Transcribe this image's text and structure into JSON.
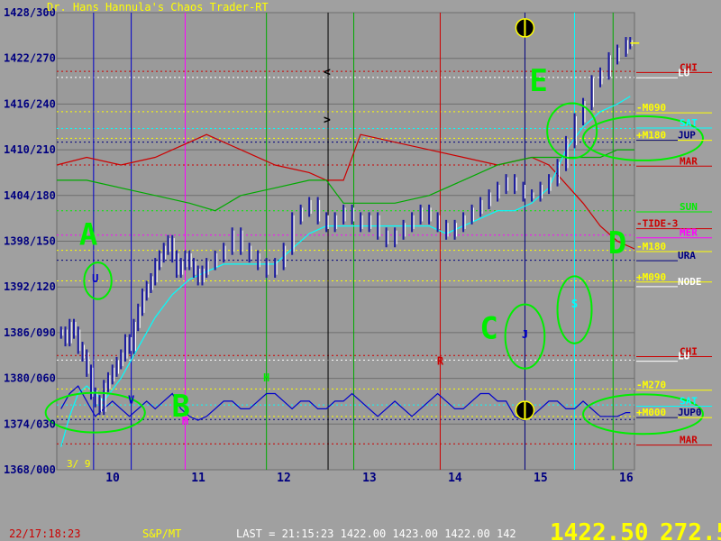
{
  "title": "Dr. Hans Hannula's Chaos Trader-RT",
  "status_bar": {
    "datetime": "22/17:18:23",
    "symbol": "S&P/MT",
    "last_quote": "LAST = 21:15:23 1422.00 1423.00 1422.00 142",
    "big_price": "1422.50",
    "big_value": "272.5"
  },
  "colors": {
    "background": "#a0a0a0",
    "plot": "#9a9a9a",
    "title": "#ffff00",
    "axis_text": "#000080",
    "status_left": "#cc0000",
    "status_mid": "#ffff00",
    "status_big": "#ffff00",
    "price_bars": "#1a1aa0",
    "price_bars_light": "#ffffff",
    "mars_line": "#cc0000",
    "green_line": "#00aa00",
    "cyan_line": "#00ffff",
    "blue_osc": "#0000cc",
    "annotation": "#00ee00"
  },
  "chart_data": {
    "type": "line",
    "title": "Dr. Hans Hannula's Chaos Trader-RT",
    "xlabel": "",
    "ylabel": "",
    "xlim": [
      9.45,
      16.2
    ],
    "ylim": [
      1368,
      1428
    ],
    "y_tick_labels": [
      "1428/300",
      "1422/270",
      "1416/240",
      "1410/210",
      "1404/180",
      "1398/150",
      "1392/120",
      "1386/090",
      "1380/060",
      "1374/030",
      "1368/000"
    ],
    "y_tick_values": [
      1428,
      1422,
      1416,
      1410,
      1404,
      1398,
      1392,
      1386,
      1380,
      1374,
      1368
    ],
    "x_tick_labels": [
      "10",
      "11",
      "12",
      "13",
      "14",
      "15",
      "16"
    ],
    "x_tick_values": [
      10,
      11,
      12,
      13,
      14,
      15,
      16
    ],
    "date_label": "3/ 9",
    "grid": true,
    "series": [
      {
        "name": "",
        "kind": "price",
        "color": "#1a1aa0",
        "x": [
          9.5,
          9.55,
          9.6,
          9.65,
          9.7,
          9.75,
          9.8,
          9.85,
          9.9,
          9.95,
          10.0,
          10.05,
          10.1,
          10.15,
          10.2,
          10.25,
          10.3,
          10.35,
          10.4,
          10.45,
          10.5,
          10.55,
          10.6,
          10.65,
          10.7,
          10.75,
          10.8,
          10.85,
          10.9,
          10.95,
          11.0,
          11.05,
          11.1,
          11.15,
          11.2,
          11.3,
          11.4,
          11.5,
          11.6,
          11.7,
          11.8,
          11.9,
          12.0,
          12.1,
          12.2,
          12.3,
          12.4,
          12.5,
          12.6,
          12.7,
          12.8,
          12.9,
          13.0,
          13.1,
          13.2,
          13.3,
          13.4,
          13.5,
          13.6,
          13.7,
          13.8,
          13.9,
          14.0,
          14.1,
          14.2,
          14.3,
          14.4,
          14.5,
          14.6,
          14.7,
          14.8,
          14.9,
          15.0,
          15.1,
          15.2,
          15.3,
          15.4,
          15.5,
          15.6,
          15.7,
          15.8,
          15.9,
          16.0,
          16.1,
          16.15
        ],
        "y": [
          1386,
          1385,
          1387,
          1386,
          1384,
          1383,
          1381,
          1378,
          1377,
          1376,
          1379,
          1380,
          1381,
          1382,
          1383,
          1385,
          1384,
          1387,
          1389,
          1391,
          1392,
          1393,
          1395,
          1396,
          1397,
          1398,
          1396,
          1394,
          1395,
          1396,
          1395,
          1394,
          1393,
          1394,
          1395,
          1396,
          1397,
          1399,
          1397,
          1396,
          1395,
          1394,
          1395,
          1397,
          1401,
          1402,
          1403,
          1401,
          1400,
          1401,
          1402,
          1401,
          1400,
          1401,
          1399,
          1398,
          1399,
          1400,
          1401,
          1402,
          1401,
          1400,
          1399,
          1400,
          1401,
          1402,
          1403,
          1404,
          1405,
          1406,
          1405,
          1404,
          1404,
          1405,
          1406,
          1408,
          1411,
          1414,
          1416,
          1419,
          1420,
          1422,
          1423,
          1424,
          1424
        ]
      },
      {
        "name": "MAR",
        "kind": "line",
        "color": "#cc0000",
        "x": [
          9.45,
          9.8,
          10.2,
          10.6,
          11.0,
          11.2,
          11.6,
          12.0,
          12.4,
          12.6,
          12.8,
          13.0,
          13.4,
          13.8,
          14.2,
          14.6,
          15.0,
          15.2,
          15.6,
          15.8,
          16.0,
          16.2
        ],
        "y": [
          1408,
          1409,
          1408,
          1409,
          1411,
          1412,
          1410,
          1408,
          1407,
          1406,
          1406,
          1412,
          1411,
          1410,
          1409,
          1408,
          1409,
          1408,
          1403,
          1400,
          1398,
          1397
        ]
      },
      {
        "name": "",
        "kind": "line",
        "color": "#00aa00",
        "x": [
          9.45,
          9.8,
          10.2,
          10.6,
          11.0,
          11.3,
          11.6,
          12.0,
          12.4,
          12.6,
          12.8,
          13.0,
          13.4,
          13.8,
          14.2,
          14.6,
          15.0,
          15.4,
          15.8,
          16.0,
          16.2
        ],
        "y": [
          1406,
          1406,
          1405,
          1404,
          1403,
          1402,
          1404,
          1405,
          1406,
          1406,
          1403,
          1403,
          1403,
          1404,
          1406,
          1408,
          1409,
          1409,
          1409,
          1410,
          1410
        ]
      },
      {
        "name": "",
        "kind": "line",
        "color": "#00ffff",
        "x": [
          9.5,
          9.6,
          9.7,
          9.8,
          9.9,
          10.0,
          10.2,
          10.4,
          10.6,
          10.8,
          11.0,
          11.2,
          11.4,
          11.6,
          11.8,
          12.0,
          12.2,
          12.4,
          12.6,
          12.8,
          13.0,
          13.2,
          13.4,
          13.6,
          13.8,
          14.0,
          14.2,
          14.4,
          14.6,
          14.8,
          15.0,
          15.2,
          15.4,
          15.6,
          15.8,
          16.0,
          16.15
        ],
        "y": [
          1371,
          1375,
          1378,
          1379,
          1378,
          1377,
          1380,
          1384,
          1388,
          1391,
          1393,
          1394,
          1395,
          1395,
          1395,
          1395,
          1397,
          1399,
          1400,
          1400,
          1400,
          1400,
          1400,
          1400,
          1400,
          1399,
          1400,
          1401,
          1402,
          1402,
          1403,
          1405,
          1410,
          1413,
          1415,
          1416,
          1417
        ]
      },
      {
        "name": "",
        "kind": "oscillator",
        "color": "#0000cc",
        "x": [
          9.5,
          9.6,
          9.7,
          9.8,
          9.9,
          10.0,
          10.1,
          10.2,
          10.3,
          10.4,
          10.5,
          10.6,
          10.7,
          10.8,
          10.9,
          11.0,
          11.1,
          11.2,
          11.3,
          11.4,
          11.5,
          11.6,
          11.7,
          11.8,
          11.9,
          12.0,
          12.1,
          12.2,
          12.3,
          12.4,
          12.5,
          12.6,
          12.7,
          12.8,
          12.9,
          13.0,
          13.1,
          13.2,
          13.3,
          13.4,
          13.5,
          13.6,
          13.7,
          13.8,
          13.9,
          14.0,
          14.1,
          14.2,
          14.3,
          14.4,
          14.5,
          14.6,
          14.7,
          14.8,
          14.9,
          15.0,
          15.1,
          15.2,
          15.3,
          15.4,
          15.5,
          15.6,
          15.7,
          15.8,
          15.9,
          16.0,
          16.1,
          16.15
        ],
        "y": [
          1376,
          1378,
          1379,
          1377,
          1375,
          1376,
          1377,
          1376,
          1375,
          1376,
          1377,
          1376,
          1377,
          1378,
          1376,
          1375,
          1374.5,
          1375,
          1376,
          1377,
          1377,
          1376,
          1376,
          1377,
          1378,
          1378,
          1377,
          1376,
          1377,
          1377,
          1376,
          1376,
          1377,
          1377,
          1378,
          1377,
          1376,
          1375,
          1376,
          1377,
          1376,
          1375,
          1376,
          1377,
          1378,
          1377,
          1376,
          1376,
          1377,
          1378,
          1378,
          1377,
          1377,
          1375,
          1374.5,
          1375,
          1376,
          1377,
          1377,
          1376,
          1376,
          1377,
          1376,
          1375,
          1375,
          1375,
          1375.5,
          1375.5
        ]
      }
    ],
    "planet_labels_right": [
      {
        "text": "CHI",
        "y": 1420.5,
        "color": "#cc0000"
      },
      {
        "text": "LU",
        "y": 1419.8,
        "color": "#ffffff"
      },
      {
        "text": "-M090",
        "y": 1415.2,
        "color": "#ffff00"
      },
      {
        "text": "SAT",
        "y": 1413.2,
        "color": "#00ffff"
      },
      {
        "text": "+M180",
        "y": 1411.6,
        "color": "#ffff00"
      },
      {
        "text": "JUP",
        "y": 1411.6,
        "color": "#000080"
      },
      {
        "text": "MAR",
        "y": 1408.2,
        "color": "#cc0000"
      },
      {
        "text": "SUN",
        "y": 1402.2,
        "color": "#00ee00"
      },
      {
        "text": "-TIDE-3",
        "y": 1400.0,
        "color": "#cc0000"
      },
      {
        "text": "MER",
        "y": 1398.8,
        "color": "#ff00ff"
      },
      {
        "text": "-M180",
        "y": 1397.0,
        "color": "#ffff00"
      },
      {
        "text": "URA",
        "y": 1395.8,
        "color": "#000080"
      },
      {
        "text": "+M090",
        "y": 1393.0,
        "color": "#ffff00"
      },
      {
        "text": "NODE",
        "y": 1392.4,
        "color": "#ffffff"
      },
      {
        "text": "CHI",
        "y": 1383.2,
        "color": "#cc0000"
      },
      {
        "text": "LU",
        "y": 1382.6,
        "color": "#ffffff"
      },
      {
        "text": "-M270",
        "y": 1378.8,
        "color": "#ffff00"
      },
      {
        "text": "SAT",
        "y": 1376.7,
        "color": "#00ffff"
      },
      {
        "text": "+M000",
        "y": 1375.2,
        "color": "#ffff00"
      },
      {
        "text": "JUP0",
        "y": 1375.2,
        "color": "#000080"
      },
      {
        "text": "MAR",
        "y": 1371.6,
        "color": "#cc0000"
      }
    ],
    "horizontal_lines": [
      {
        "y": 1420.3,
        "color": "#cc0000"
      },
      {
        "y": 1419.5,
        "color": "#ffffff"
      },
      {
        "y": 1415.0,
        "color": "#ffff00"
      },
      {
        "y": 1412.8,
        "color": "#00ffff"
      },
      {
        "y": 1411.5,
        "color": "#ffff00"
      },
      {
        "y": 1411.0,
        "color": "#000080"
      },
      {
        "y": 1408.0,
        "color": "#cc0000"
      },
      {
        "y": 1402.0,
        "color": "#00ee00"
      },
      {
        "y": 1398.8,
        "color": "#ff00ff"
      },
      {
        "y": 1396.8,
        "color": "#ffff00"
      },
      {
        "y": 1395.5,
        "color": "#000080"
      },
      {
        "y": 1392.8,
        "color": "#ffff00"
      },
      {
        "y": 1383.0,
        "color": "#cc0000"
      },
      {
        "y": 1382.4,
        "color": "#ffffff"
      },
      {
        "y": 1378.6,
        "color": "#ffff00"
      },
      {
        "y": 1376.5,
        "color": "#00ffff"
      },
      {
        "y": 1375.0,
        "color": "#ffff00"
      },
      {
        "y": 1374.6,
        "color": "#000080"
      },
      {
        "y": 1371.4,
        "color": "#cc0000"
      }
    ],
    "vertical_lines": [
      {
        "x": 9.88,
        "color": "#0000cc"
      },
      {
        "x": 10.32,
        "color": "#0000cc"
      },
      {
        "x": 10.95,
        "color": "#ff00ff"
      },
      {
        "x": 11.9,
        "color": "#00aa00"
      },
      {
        "x": 12.62,
        "color": "#000000"
      },
      {
        "x": 12.92,
        "color": "#00aa00"
      },
      {
        "x": 13.93,
        "color": "#cc0000"
      },
      {
        "x": 14.92,
        "color": "#000080"
      },
      {
        "x": 15.5,
        "color": "#00ffff"
      },
      {
        "x": 15.95,
        "color": "#00aa00"
      }
    ],
    "moon_markers": [
      {
        "x": 14.92,
        "y": 1426
      },
      {
        "x": 14.92,
        "y": 1375.8
      }
    ],
    "chevrons": [
      {
        "text": "<",
        "x": 12.62,
        "y": 1420.2
      },
      {
        "text": ">",
        "x": 12.62,
        "y": 1413.9
      }
    ],
    "annotations": [
      {
        "text": "A",
        "x": 9.82,
        "y": 1397.5,
        "color": "#00ee00",
        "size": "large"
      },
      {
        "text": "B",
        "x": 10.9,
        "y": 1375.0,
        "color": "#00ee00",
        "size": "large"
      },
      {
        "text": "C",
        "x": 14.5,
        "y": 1385.2,
        "color": "#00ee00",
        "size": "large"
      },
      {
        "text": "D",
        "x": 16.0,
        "y": 1396.4,
        "color": "#00ee00",
        "size": "large"
      },
      {
        "text": "E",
        "x": 15.08,
        "y": 1417.7,
        "color": "#00ee00",
        "size": "large"
      },
      {
        "text": "U",
        "x": 9.9,
        "y": 1392.6,
        "color": "#0000cc",
        "size": "small"
      },
      {
        "text": "J",
        "x": 14.92,
        "y": 1385.3,
        "color": "#0000cc",
        "size": "small"
      },
      {
        "text": "S",
        "x": 15.5,
        "y": 1389.3,
        "color": "#00ffff",
        "size": "small"
      },
      {
        "text": "R",
        "x": 13.93,
        "y": 1381.8,
        "color": "#cc0000",
        "size": "small"
      },
      {
        "text": "H",
        "x": 11.9,
        "y": 1379.6,
        "color": "#00ee00",
        "size": "small"
      },
      {
        "text": "M",
        "x": 10.95,
        "y": 1373.9,
        "color": "#ff00ff",
        "size": "small"
      },
      {
        "text": "V",
        "x": 10.32,
        "y": 1376.7,
        "color": "#0000cc",
        "size": "small"
      }
    ],
    "ellipses": [
      {
        "cx": 9.93,
        "cy": 1392.8,
        "rx": 0.16,
        "ry": 2.4
      },
      {
        "cx": 9.9,
        "cy": 1375.5,
        "rx": 0.58,
        "ry": 2.6
      },
      {
        "cx": 14.92,
        "cy": 1385.5,
        "rx": 0.23,
        "ry": 4.2
      },
      {
        "cx": 15.5,
        "cy": 1389.0,
        "rx": 0.2,
        "ry": 4.4
      },
      {
        "cx": 15.47,
        "cy": 1412.5,
        "rx": 0.29,
        "ry": 3.6
      },
      {
        "cx": 16.3,
        "cy": 1411.5,
        "rx": 0.7,
        "ry": 2.9
      },
      {
        "cx": 16.3,
        "cy": 1375.3,
        "rx": 0.7,
        "ry": 2.6
      }
    ]
  }
}
